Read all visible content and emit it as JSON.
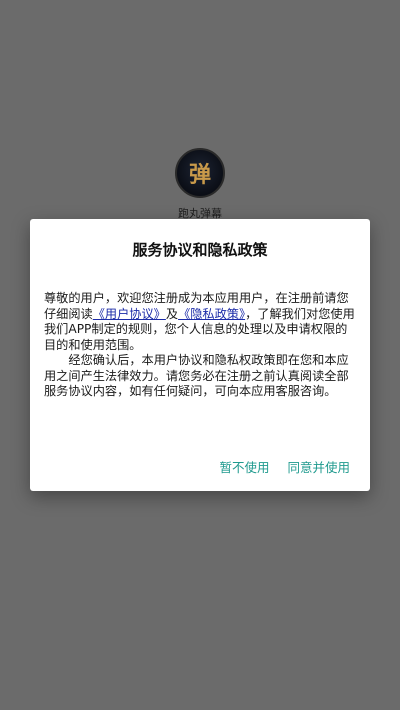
{
  "app": {
    "logo_char": "弹",
    "name": "跑丸弹幕"
  },
  "dialog": {
    "title": "服务协议和隐私政策",
    "para1_before": "尊敬的用户，欢迎您注册成为本应用用户，在注册前请您仔细阅读",
    "link_user_agreement": "《用户协议》",
    "para1_and": "及",
    "link_privacy_policy": "《隐私政策》",
    "para1_after": "，了解我们对您使用我们APP制定的规则，您个人信息的处理以及申请权限的目的和使用范围。",
    "para2": "经您确认后，本用户协议和隐私权政策即在您和本应用之间产生法律效力。请您务必在注册之前认真阅读全部服务协议内容，如有任何疑问，可向本应用客服咨询。",
    "btn_decline": "暂不使用",
    "btn_accept": "同意并使用"
  },
  "colors": {
    "overlay": "#6b6b6b",
    "link": "#1b2ba8",
    "accent": "#1f9a8e"
  }
}
